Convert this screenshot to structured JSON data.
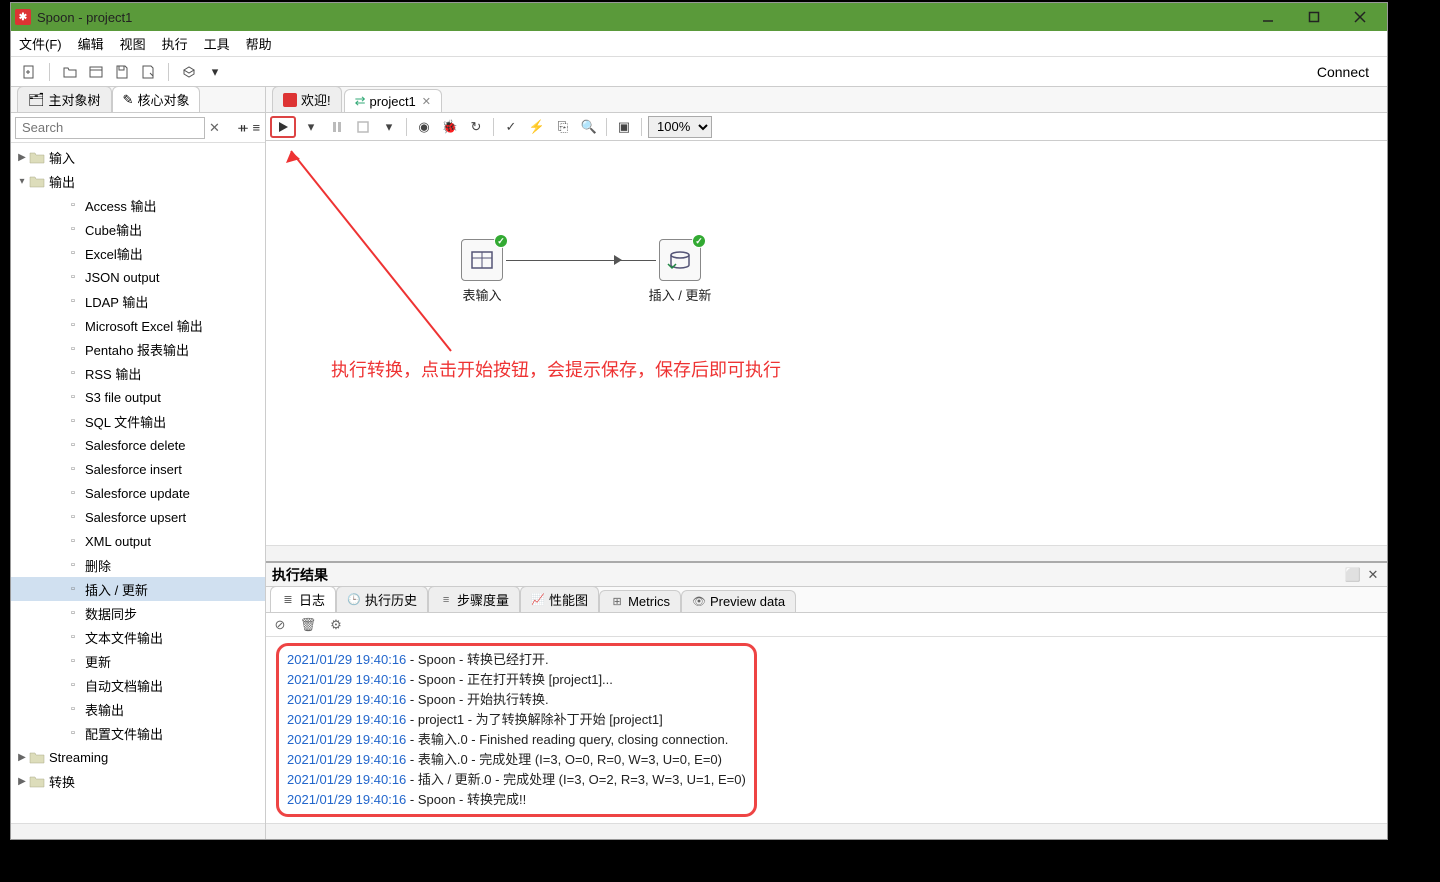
{
  "window": {
    "title": "Spoon - project1"
  },
  "menu": {
    "file": "文件(F)",
    "edit": "编辑",
    "view": "视图",
    "run": "执行",
    "tools": "工具",
    "help": "帮助"
  },
  "toolbar": {
    "connect": "Connect"
  },
  "sidebar": {
    "tab_main": "主对象树",
    "tab_core": "核心对象",
    "search_placeholder": "Search",
    "tree": {
      "input": "输入",
      "output": "输出",
      "items": [
        "Access 输出",
        "Cube输出",
        "Excel输出",
        "JSON output",
        "LDAP 输出",
        "Microsoft Excel 输出",
        "Pentaho 报表输出",
        "RSS 输出",
        "S3 file output",
        "SQL 文件输出",
        "Salesforce delete",
        "Salesforce insert",
        "Salesforce update",
        "Salesforce upsert",
        "XML output",
        "删除",
        "插入 / 更新",
        "数据同步",
        "文本文件输出",
        "更新",
        "自动文档输出",
        "表输出",
        "配置文件输出"
      ],
      "streaming": "Streaming",
      "transform": "转换"
    }
  },
  "editor": {
    "tab_welcome": "欢迎!",
    "tab_project": "project1",
    "zoom": "100%",
    "steps": {
      "table_input": "表输入",
      "insert_update": "插入 / 更新"
    },
    "annotation": "执行转换，点击开始按钮，会提示保存，保存后即可执行"
  },
  "results": {
    "title": "执行结果",
    "tabs": {
      "log": "日志",
      "history": "执行历史",
      "step_metrics": "步骤度量",
      "perf": "性能图",
      "metrics": "Metrics",
      "preview": "Preview data"
    },
    "log": [
      {
        "ts": "2021/01/29 19:40:16",
        "msg": " - Spoon - 转换已经打开."
      },
      {
        "ts": "2021/01/29 19:40:16",
        "msg": " - Spoon - 正在打开转换 [project1]..."
      },
      {
        "ts": "2021/01/29 19:40:16",
        "msg": " - Spoon - 开始执行转换."
      },
      {
        "ts": "2021/01/29 19:40:16",
        "msg": " - project1 - 为了转换解除补丁开始  [project1]"
      },
      {
        "ts": "2021/01/29 19:40:16",
        "msg": " - 表输入.0 - Finished reading query, closing connection."
      },
      {
        "ts": "2021/01/29 19:40:16",
        "msg": " - 表输入.0 - 完成处理 (I=3, O=0, R=0, W=3, U=0, E=0)"
      },
      {
        "ts": "2021/01/29 19:40:16",
        "msg": " - 插入 / 更新.0 - 完成处理 (I=3, O=2, R=3, W=3, U=1, E=0)"
      },
      {
        "ts": "2021/01/29 19:40:16",
        "msg": " - Spoon - 转换完成!!"
      }
    ]
  }
}
